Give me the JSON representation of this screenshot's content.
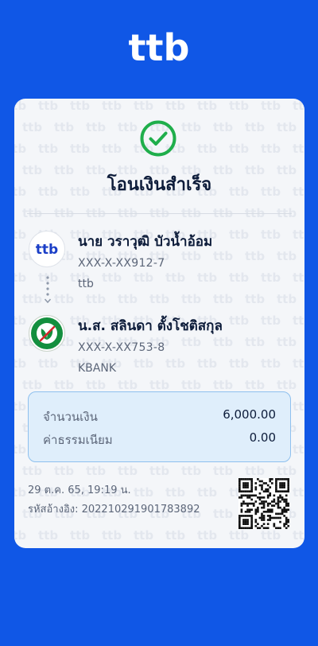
{
  "brand": {
    "logo_text": "ttb",
    "bg_color": "#1057e6"
  },
  "receipt": {
    "title": "โอนเงินสำเร็จ",
    "status_icon": "check-circle-icon",
    "from": {
      "name": "นาย วราวุฒิ  บัวน้ำอ้อม",
      "account": "XXX-X-XX912-7",
      "bank": "ttb",
      "bank_logo_text": "ttb"
    },
    "to": {
      "name": "น.ส. สลินดา ตั้งโชติสกุล",
      "account": "XXX-X-XX753-8",
      "bank": "KBANK"
    },
    "amount_label": "จำนวนเงิน",
    "amount_value": "6,000.00",
    "fee_label": "ค่าธรรมเนียม",
    "fee_value": "0.00",
    "datetime": "29 ต.ค. 65, 19:19 น.",
    "reference": "รหัสอ้างอิง: 202210291901783892",
    "qr_icon": "qr-code-icon"
  },
  "colors": {
    "success": "#1fae4b",
    "kbank": "#138f3e"
  }
}
